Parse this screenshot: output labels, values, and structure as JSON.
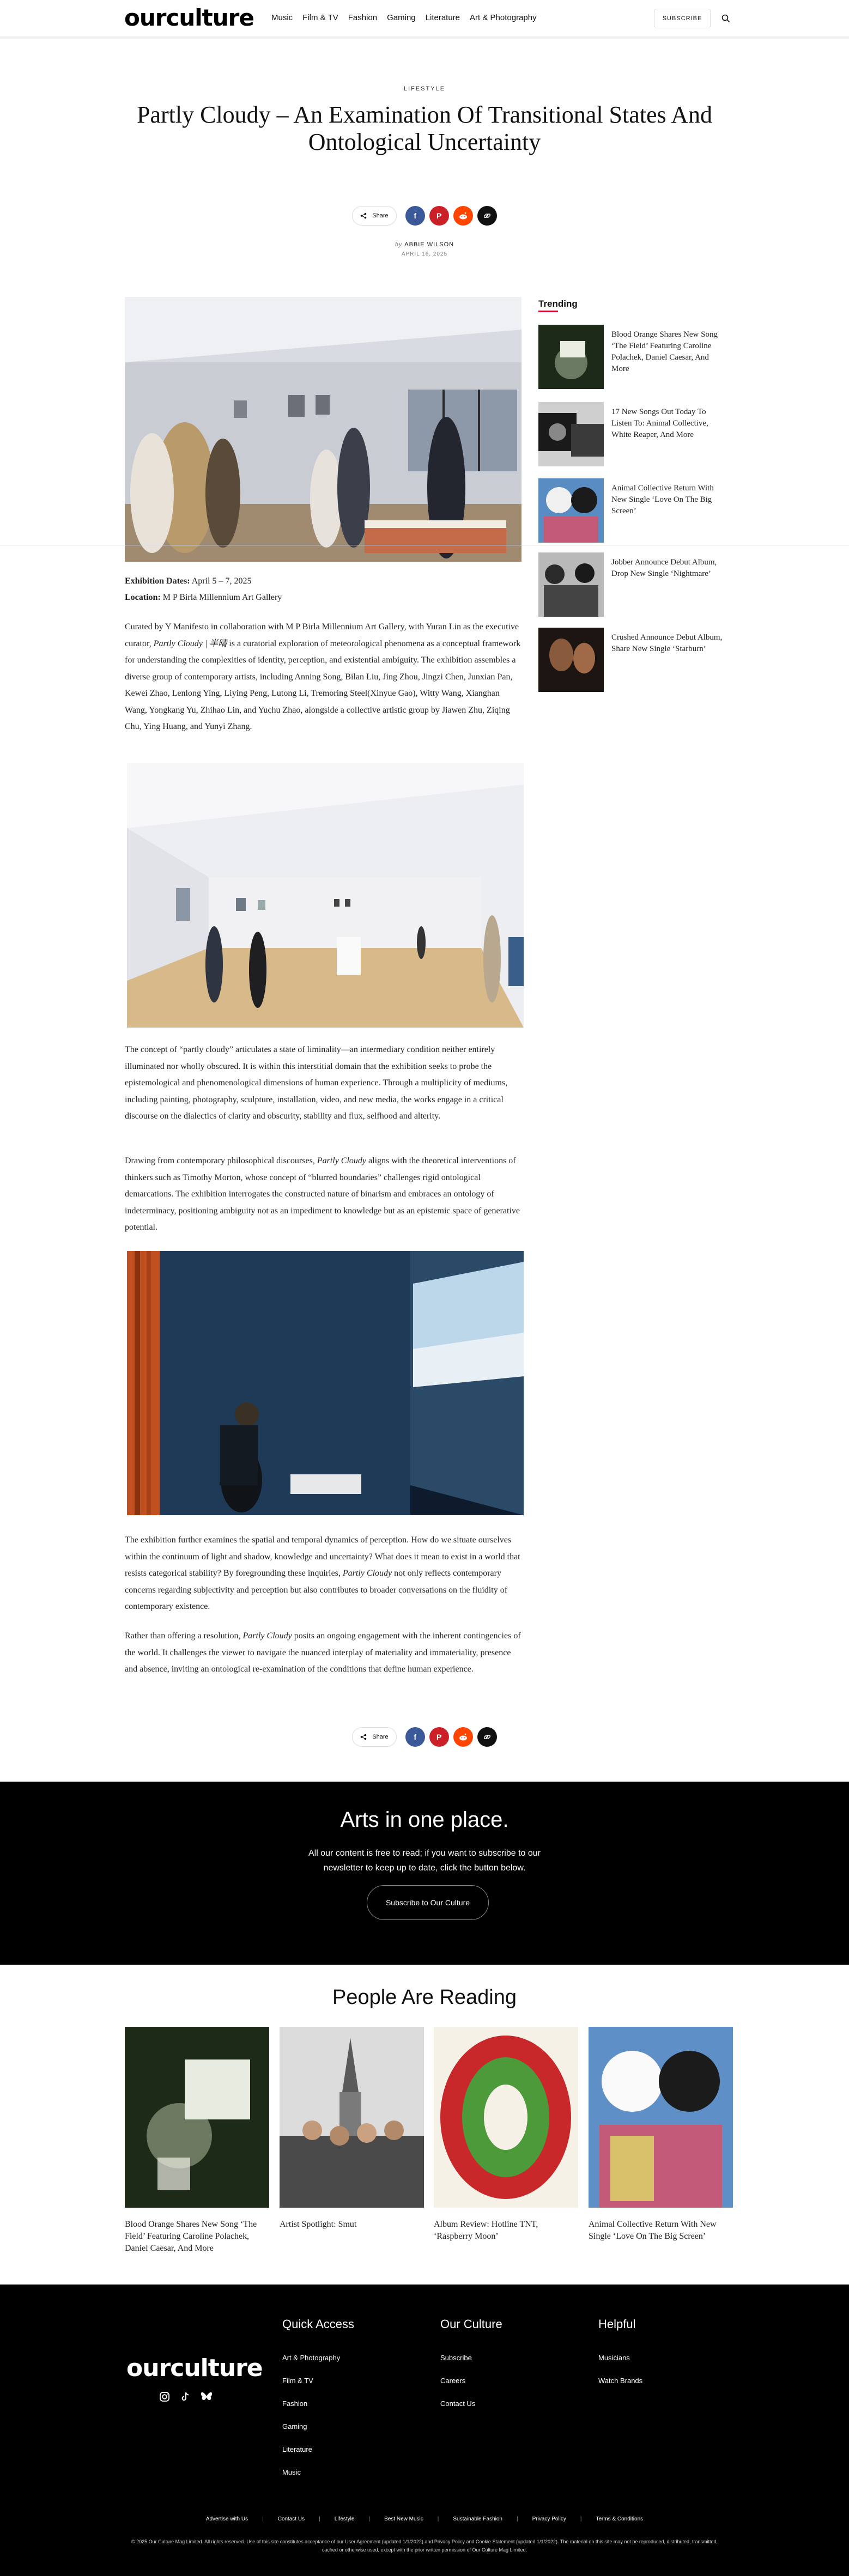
{
  "header": {
    "logo": "ourculture",
    "nav": [
      "Music",
      "Film & TV",
      "Fashion",
      "Gaming",
      "Literature",
      "Art & Photography"
    ],
    "subscribe_label": "SUBSCRIBE"
  },
  "article": {
    "category": "LIFESTYLE",
    "title": "Partly Cloudy – An Examination Of Transitional States And Ontological Uncertainty",
    "share_label": "Share",
    "author_prefix": "by",
    "author": "ABBIE WILSON",
    "date": "APRIL 16, 2025",
    "dates_label": "Exhibition Dates:",
    "dates_value": "April 5 – 7, 2025",
    "location_label": "Location:",
    "location_value": "M P Birla Millennium Art Gallery",
    "p1_a": "Curated by Y Manifesto in collaboration with M P Birla Millennium Art Gallery, with Yuran Lin as the executive curator, ",
    "p1_em": "Partly Cloudy | 半晴",
    "p1_b": " is a curatorial exploration of meteorological phenomena as a conceptual framework for understanding the complexities of identity, perception, and existential ambiguity. The exhibition assembles a diverse group of contemporary artists, including Anning Song, Bilan Liu, Jing Zhou, Jingzi Chen, Junxian Pan, Kewei Zhao, Lenlong Ying, Liying Peng, Lutong Li, Tremoring Steel(Xinyue Gao), Witty Wang, Xianghan Wang, Yongkang Yu, Zhihao Lin, and Yuchu Zhao, alongside a collective artistic group by Jiawen Zhu, Ziqing Chu, Ying Huang, and Yunyi Zhang.",
    "p2": "The concept of “partly cloudy” articulates a state of liminality—an intermediary condition neither entirely illuminated nor wholly obscured. It is within this interstitial domain that the exhibition seeks to probe the epistemological and phenomenological dimensions of human experience. Through a multiplicity of mediums, including painting, photography, sculpture, installation, video, and new media, the works engage in a critical discourse on the dialectics of clarity and obscurity, stability and flux, selfhood and alterity.",
    "p3_a": "Drawing from contemporary philosophical discourses, ",
    "p3_em": "Partly Cloudy",
    "p3_b": " aligns with the theoretical interventions of thinkers such as Timothy Morton, whose concept of “blurred boundaries” challenges rigid ontological demarcations. The exhibition interrogates the constructed nature of binarism and embraces an ontology of indeterminacy, positioning ambiguity not as an impediment to knowledge but as an epistemic space of generative potential.",
    "p4_a": "The exhibition further examines the spatial and temporal dynamics of perception. How do we situate ourselves within the continuum of light and shadow, knowledge and uncertainty? What does it mean to exist in a world that resists categorical stability? By foregrounding these inquiries, ",
    "p4_em": "Partly Cloudy",
    "p4_b": " not only reflects contemporary concerns regarding subjectivity and perception but also contributes to broader conversations on the fluidity of contemporary existence.",
    "p5_a": "Rather than offering a resolution, ",
    "p5_em": "Partly Cloudy",
    "p5_b": " posits an ongoing engagement with the inherent contingencies of the world. It challenges the viewer to navigate the nuanced interplay of materiality and immateriality, presence and absence, inviting an ontological re-examination of the conditions that define human experience."
  },
  "trending": {
    "heading": "Trending",
    "items": [
      "Blood Orange Shares New Song ‘The Field’ Featuring Caroline Polachek, Daniel Caesar, And More",
      "17 New Songs Out Today To Listen To: Animal Collective, White Reaper, And More",
      "Animal Collective Return With New Single ‘Love On The Big Screen’",
      "Jobber Announce Debut Album, Drop New Single ‘Nightmare’",
      "Crushed Announce Debut Album, Share New Single ‘Starburn’"
    ]
  },
  "subscribe_band": {
    "heading": "Arts in one place.",
    "text": "All our content is free to read; if you want to subscribe to our newsletter to keep up to date, click the button below.",
    "button": "Subscribe to Our Culture"
  },
  "people_reading": {
    "heading": "People Are Reading",
    "items": [
      "Blood Orange Shares New Song ‘The Field’ Featuring Caroline Polachek, Daniel Caesar, And More",
      "Artist Spotlight: Smut",
      "Album Review: Hotline TNT, ‘Raspberry Moon’",
      "Animal Collective Return With New Single ‘Love On The Big Screen’"
    ]
  },
  "footer": {
    "logo": "ourculture",
    "quick_access_heading": "Quick Access",
    "quick_access": [
      "Art & Photography",
      "Film & TV",
      "Fashion",
      "Gaming",
      "Literature",
      "Music"
    ],
    "our_culture_heading": "Our Culture",
    "our_culture": [
      "Subscribe",
      "Careers",
      "Contact Us"
    ],
    "helpful_heading": "Helpful",
    "helpful": [
      "Musicians",
      "Watch Brands"
    ],
    "bottom_links": [
      "Advertise with Us",
      "Contact Us",
      "Lifestyle",
      "Best New Music",
      "Sustainable Fashion",
      "Privacy Policy",
      "Terms & Conditions"
    ],
    "legal": "© 2025 Our Culture Mag Limited. All rights reserved. Use of this site constitutes acceptance of our User Agreement (updated 1/1/2022) and Privacy Policy and Cookie Statement (updated 1/1/2022). The material on this site may not be reproduced, distributed, transmitted, cached or otherwise used, except with the prior written permission of Our Culture Mag Limited."
  },
  "colors": {
    "facebook": "#3b5998",
    "pinterest": "#cb2027",
    "reddit": "#ff4500",
    "link": "#111111",
    "accent": "#c8102e"
  }
}
